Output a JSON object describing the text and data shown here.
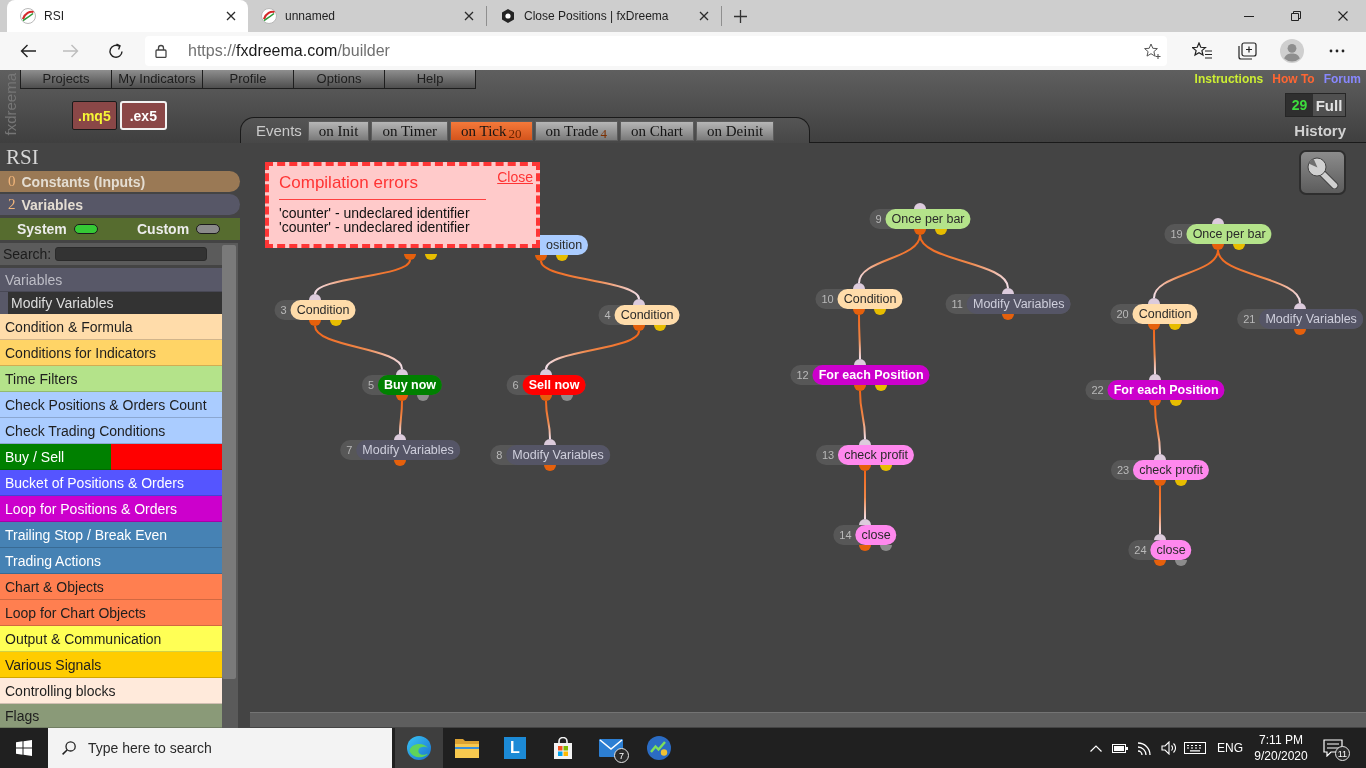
{
  "browser": {
    "tabs": [
      {
        "title": "RSI",
        "kind": "swirl",
        "selected": true
      },
      {
        "title": "unnamed",
        "kind": "swirl",
        "selected": false
      },
      {
        "title": "Close Positions | fxDreema",
        "kind": "hexagon",
        "selected": false
      }
    ],
    "navigation": [
      {
        "kind": "back",
        "disabled": false
      },
      {
        "kind": "forward",
        "disabled": true
      },
      {
        "kind": "reload",
        "disabled": false
      }
    ],
    "address": {
      "scheme": "https://",
      "host": "fxdreema.com",
      "path": "/builder"
    }
  },
  "header": {
    "brand": "fxdreema",
    "menu": [
      "Projects",
      "My Indicators",
      "Profile",
      "Options",
      "Help"
    ],
    "formats": [
      {
        "label": ".mq5",
        "selected": false
      },
      {
        "label": ".ex5",
        "selected": true
      }
    ],
    "events": {
      "label": "Events",
      "tabs": [
        {
          "label": "on Init",
          "selected": false
        },
        {
          "label": "on Timer",
          "selected": false
        },
        {
          "label": "on Tick",
          "count": "20",
          "selected": true
        },
        {
          "label": "on Trade",
          "count": "4",
          "selected": false
        },
        {
          "label": "on Chart",
          "selected": false
        },
        {
          "label": "on Deinit",
          "selected": false
        }
      ]
    },
    "links": [
      {
        "label": "Instructions",
        "color": "#ccee33"
      },
      {
        "label": "How To",
        "color": "#ff6633"
      },
      {
        "label": "Forum",
        "color": "#8888ff"
      }
    ],
    "history": {
      "count": "29",
      "mode": "Full",
      "label": "History"
    }
  },
  "sidebar": {
    "project": "RSI",
    "constants": {
      "count": "0",
      "label": "Constants (Inputs)"
    },
    "variables": {
      "count": "2",
      "label": "Variables"
    },
    "filters": [
      {
        "label": "System",
        "on": true
      },
      {
        "label": "Custom",
        "on": false
      }
    ],
    "search": {
      "label": "Search:"
    },
    "groups": [
      {
        "label": "Variables",
        "kind": "header"
      },
      {
        "label": "Modify Variables",
        "kind": "block"
      },
      {
        "label": "Condition & Formula",
        "kind": "category",
        "color": "#ffdcaa"
      },
      {
        "label": "Conditions for Indicators",
        "kind": "category",
        "color": "#ffd466"
      },
      {
        "label": "Time Filters",
        "kind": "category",
        "color": "#b4e38a"
      },
      {
        "label": "Check Positions & Orders Count",
        "kind": "category",
        "color": "#aaccff"
      },
      {
        "label": "Check Trading Conditions",
        "kind": "category",
        "color": "#aaccff"
      },
      {
        "label": "Buy / Sell",
        "kind": "split",
        "parts": [
          {
            "color": "#008000"
          },
          {
            "color": "#ff0000"
          }
        ]
      },
      {
        "label": "Bucket of Positions & Orders",
        "kind": "category",
        "color": "#5555ff"
      },
      {
        "label": "Loop for Positions & Orders",
        "kind": "category",
        "color": "#cc00cc"
      },
      {
        "label": "Trailing Stop / Break Even",
        "kind": "category",
        "color": "#4682b4"
      },
      {
        "label": "Trading Actions",
        "kind": "category",
        "color": "#4682b4"
      },
      {
        "label": "Chart & Objects",
        "kind": "category",
        "color": "#ff7f50"
      },
      {
        "label": "Loop for Chart Objects",
        "kind": "category",
        "color": "#ff7f50"
      },
      {
        "label": "Output & Communication",
        "kind": "category",
        "color": "#ffff55"
      },
      {
        "label": "Various Signals",
        "kind": "category",
        "color": "#ffcc00"
      },
      {
        "label": "Controlling blocks",
        "kind": "category",
        "color": "#ffeadb"
      },
      {
        "label": "Flags",
        "kind": "category",
        "color": "#8a9a78"
      }
    ]
  },
  "canvas": {
    "error_popup": {
      "title": "Compilation errors",
      "close": "Close",
      "messages": [
        "'counter' - undeclared identifier",
        "'counter' - undeclared identifier"
      ]
    },
    "trees": [
      {
        "kind": "branch",
        "children": [
          {
            "number": "3",
            "label": "Condition",
            "kind": "branch",
            "color": "#ffdcaa",
            "children": [
              {
                "number": "5",
                "label": "Buy now",
                "kind": "action",
                "color": "#008000",
                "children": [
                  {
                    "number": "7",
                    "label": "Modify Variables",
                    "kind": "plain",
                    "color": "#555566"
                  }
                ]
              }
            ]
          }
        ]
      },
      {
        "label": "osition",
        "kind": "branch",
        "color": "#aaccff",
        "children": [
          {
            "number": "4",
            "label": "Condition",
            "kind": "branch",
            "color": "#ffdcaa",
            "children": [
              {
                "number": "6",
                "label": "Sell now",
                "kind": "action",
                "color": "#ff0000",
                "children": [
                  {
                    "number": "8",
                    "label": "Modify Variables",
                    "kind": "plain",
                    "color": "#555566"
                  }
                ]
              }
            ]
          }
        ]
      },
      {
        "number": "9",
        "label": "Once per bar",
        "kind": "branch",
        "color": "#b4e38a",
        "children": [
          {
            "number": "10",
            "label": "Condition",
            "kind": "branch",
            "color": "#ffdcaa",
            "children": [
              {
                "number": "12",
                "label": "For each Position",
                "kind": "branch",
                "color": "#cc00cc",
                "children": [
                  {
                    "number": "13",
                    "label": "check profit",
                    "kind": "branch",
                    "color": "#ff88ee",
                    "children": [
                      {
                        "number": "14",
                        "label": "close",
                        "kind": "action",
                        "color": "#ff88ee"
                      }
                    ]
                  }
                ]
              }
            ]
          },
          {
            "number": "11",
            "label": "Modify Variables",
            "kind": "plain",
            "color": "#555566"
          }
        ]
      },
      {
        "number": "19",
        "label": "Once per bar",
        "kind": "branch",
        "color": "#b4e38a",
        "children": [
          {
            "number": "20",
            "label": "Condition",
            "kind": "branch",
            "color": "#ffdcaa",
            "children": [
              {
                "number": "22",
                "label": "For each Position",
                "kind": "branch",
                "color": "#cc00cc",
                "children": [
                  {
                    "number": "23",
                    "label": "check profit",
                    "kind": "branch",
                    "color": "#ff88ee",
                    "children": [
                      {
                        "number": "24",
                        "label": "close",
                        "kind": "action",
                        "color": "#ff88ee"
                      }
                    ]
                  }
                ]
              }
            ]
          },
          {
            "number": "21",
            "label": "Modify Variables",
            "kind": "plain",
            "color": "#555566"
          }
        ]
      }
    ]
  },
  "taskbar": {
    "search": {
      "placeholder": "Type here to search"
    },
    "apps": [
      {
        "kind": "browser",
        "selected": true
      },
      {
        "kind": "folder",
        "selected": false
      },
      {
        "kind": "tile",
        "label": "L",
        "selected": false
      },
      {
        "kind": "store",
        "selected": false
      },
      {
        "kind": "mail",
        "badge": "7",
        "selected": false
      },
      {
        "kind": "chart",
        "selected": false
      }
    ],
    "language": "ENG",
    "time": "7:11 PM",
    "date": "9/20/2020",
    "notifications": "11"
  }
}
